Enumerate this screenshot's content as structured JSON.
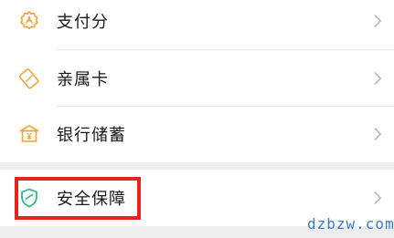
{
  "menu": {
    "items": [
      {
        "label": "支付分",
        "icon": "payscore-icon"
      },
      {
        "label": "亲属卡",
        "icon": "family-card-icon"
      },
      {
        "label": "银行储蓄",
        "icon": "bank-savings-icon"
      },
      {
        "label": "安全保障",
        "icon": "security-shield-icon"
      }
    ]
  },
  "colors": {
    "icon_orange": "#f2a33a",
    "icon_green": "#2bb67d",
    "highlight_red": "#e8231c",
    "watermark_blue": "#3a7cc7"
  },
  "watermark": {
    "text": "dzbzw.com"
  }
}
